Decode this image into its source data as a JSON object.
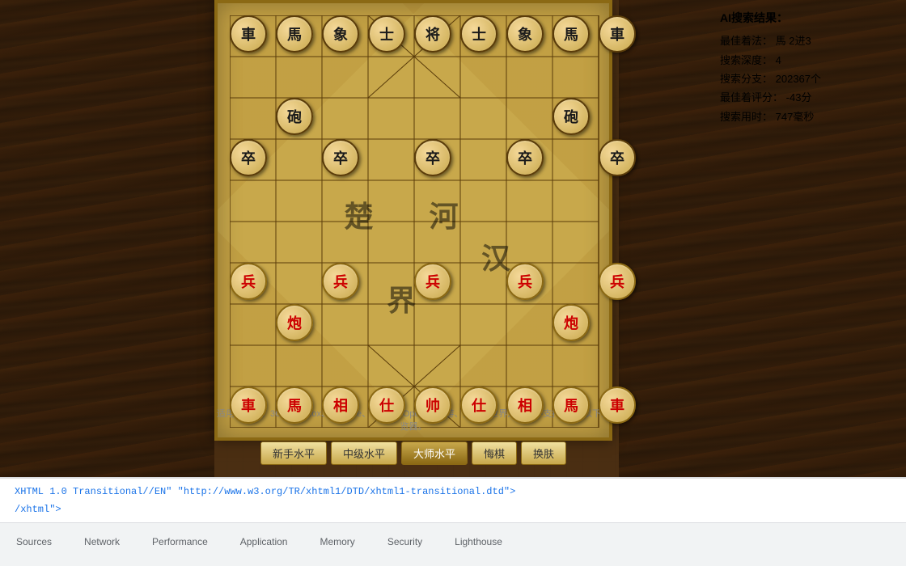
{
  "board": {
    "river_left": "楚 河",
    "river_right": "汉 界",
    "background_color": "#c8a84b"
  },
  "ai_results": {
    "title": "AI搜索结果：",
    "best_move_label": "最佳着法：",
    "best_move_value": "馬 2进3",
    "search_depth_label": "搜索深度：",
    "search_depth_value": "4",
    "search_count_label": "搜索分支：",
    "search_count_value": "202367个",
    "best_score_label": "最佳着评分：",
    "best_score_value": "-43分",
    "search_time_label": "搜索用时：",
    "search_time_value": "747毫秒"
  },
  "buttons": [
    {
      "id": "btn1",
      "label": "新手水平",
      "active": false
    },
    {
      "id": "btn2",
      "label": "中级水平",
      "active": false
    },
    {
      "id": "btn3",
      "label": "大师水平",
      "active": true
    },
    {
      "id": "btn4",
      "label": "悔棋",
      "active": false
    },
    {
      "id": "btn5",
      "label": "换肤",
      "active": false
    }
  ],
  "browser_info": "适用浏览器：360、Firefox、Chrome、Safari、Opera、傲游、搜狗、世界之窗，不支持IE8及以下浏览器。",
  "devtools": {
    "tabs": [
      {
        "id": "sources",
        "label": "Sources",
        "active": false
      },
      {
        "id": "network",
        "label": "Network",
        "active": false
      },
      {
        "id": "performance",
        "label": "Performance",
        "active": false
      },
      {
        "id": "application",
        "label": "Application",
        "active": false
      },
      {
        "id": "memory",
        "label": "Memory",
        "active": false
      },
      {
        "id": "security",
        "label": "Security",
        "active": false
      },
      {
        "id": "lighthouse",
        "label": "Lighthouse",
        "active": false
      }
    ],
    "console_lines": [
      "XHTML 1.0 Transitional//EN\" \"http://www.w3.org/TR/xhtml1/DTD/xhtml1-transitional.dtd\">",
      "/xhtml\">"
    ]
  },
  "pieces": {
    "black": [
      {
        "char": "車",
        "col": 0,
        "row": 0
      },
      {
        "char": "馬",
        "col": 1,
        "row": 0
      },
      {
        "char": "象",
        "col": 2,
        "row": 0
      },
      {
        "char": "士",
        "col": 3,
        "row": 0
      },
      {
        "char": "将",
        "col": 4,
        "row": 0
      },
      {
        "char": "士",
        "col": 5,
        "row": 0
      },
      {
        "char": "象",
        "col": 6,
        "row": 0
      },
      {
        "char": "馬",
        "col": 7,
        "row": 0
      },
      {
        "char": "車",
        "col": 8,
        "row": 0
      },
      {
        "char": "砲",
        "col": 1,
        "row": 2
      },
      {
        "char": "砲",
        "col": 7,
        "row": 2
      },
      {
        "char": "卒",
        "col": 0,
        "row": 3
      },
      {
        "char": "卒",
        "col": 2,
        "row": 3
      },
      {
        "char": "卒",
        "col": 4,
        "row": 3
      },
      {
        "char": "卒",
        "col": 6,
        "row": 3
      },
      {
        "char": "卒",
        "col": 8,
        "row": 3
      }
    ],
    "red": [
      {
        "char": "兵",
        "col": 0,
        "row": 6
      },
      {
        "char": "兵",
        "col": 2,
        "row": 6
      },
      {
        "char": "兵",
        "col": 4,
        "row": 6
      },
      {
        "char": "兵",
        "col": 6,
        "row": 6
      },
      {
        "char": "兵",
        "col": 8,
        "row": 6
      },
      {
        "char": "炮",
        "col": 1,
        "row": 7
      },
      {
        "char": "炮",
        "col": 7,
        "row": 7
      },
      {
        "char": "車",
        "col": 0,
        "row": 9
      },
      {
        "char": "馬",
        "col": 1,
        "row": 9
      },
      {
        "char": "相",
        "col": 2,
        "row": 9
      },
      {
        "char": "仕",
        "col": 3,
        "row": 9
      },
      {
        "char": "帅",
        "col": 4,
        "row": 9
      },
      {
        "char": "仕",
        "col": 5,
        "row": 9
      },
      {
        "char": "相",
        "col": 6,
        "row": 9
      },
      {
        "char": "馬",
        "col": 7,
        "row": 9
      },
      {
        "char": "車",
        "col": 8,
        "row": 9
      }
    ]
  }
}
